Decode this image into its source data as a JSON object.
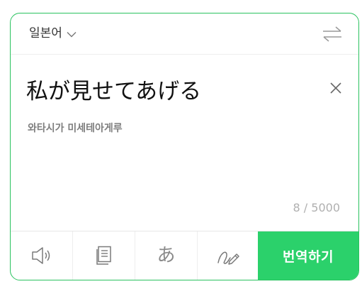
{
  "header": {
    "source_language": "일본어",
    "icons": {
      "dropdown": "chevron-down-icon",
      "swap": "swap-arrows-icon"
    }
  },
  "input": {
    "text": "私が見せてあげる",
    "pronunciation": "와타시가 미세테아게루",
    "char_count": "8 / 5000",
    "clear_icon": "close-icon"
  },
  "toolbar": {
    "tools": [
      {
        "icon": "speaker-icon"
      },
      {
        "icon": "document-icon"
      },
      {
        "icon": "hiragana-keyboard-icon",
        "glyph": "あ"
      },
      {
        "icon": "handwriting-icon"
      }
    ],
    "translate_label": "번역하기"
  },
  "colors": {
    "accent": "#2bd16b",
    "border": "#2ac25f"
  }
}
